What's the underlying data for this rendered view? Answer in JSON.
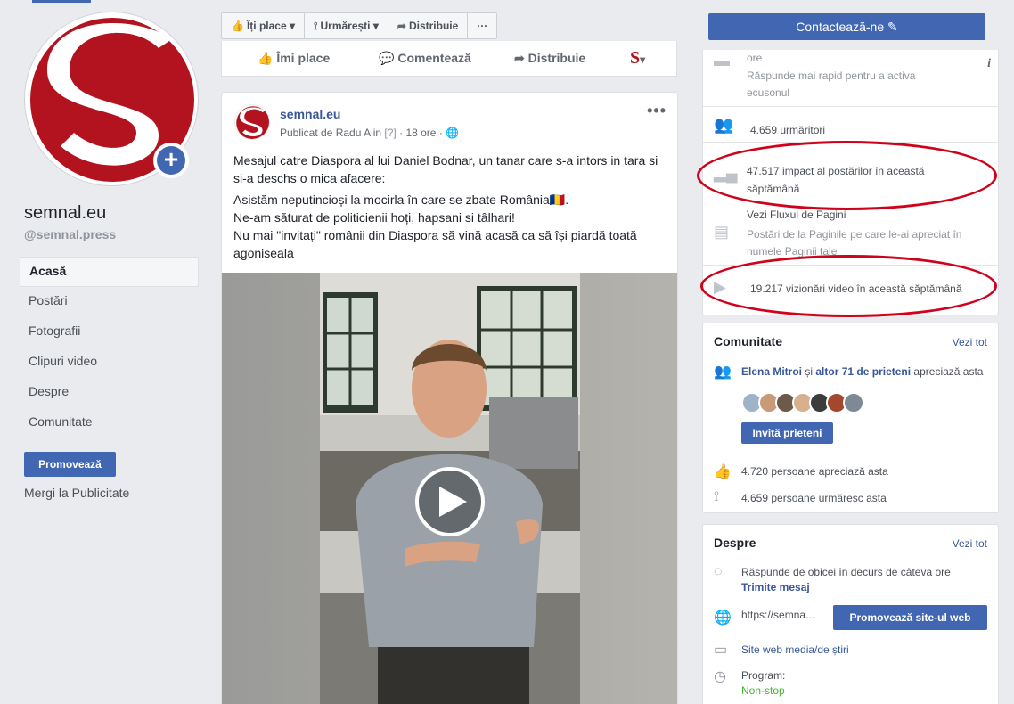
{
  "page": {
    "name": "semnal.eu",
    "handle": "@semnal.press"
  },
  "left_nav": {
    "items": [
      "Acasă",
      "Postări",
      "Fotografii",
      "Clipuri video",
      "Despre",
      "Comunitate"
    ],
    "promote_label": "Promovează",
    "ads_link": "Mergi la Publicitate"
  },
  "toolbar": {
    "like": "Îți place",
    "follow": "Urmărești",
    "share": "Distribuie",
    "more": "···",
    "contact": "Contactează-ne"
  },
  "action_row": {
    "like": "Îmi place",
    "comment": "Comentează",
    "share": "Distribuie"
  },
  "post": {
    "author": "semnal.eu",
    "published_by": "Publicat de Radu Alin",
    "help_mark": "[?]",
    "time": "18 ore",
    "dots": "•••",
    "para1": "Mesajul catre Diaspora al lui Daniel Bodnar, un tanar care s-a intors in tara si si-a deschs o mica afacere:",
    "line1": "Asistăm neputincioși la mocirla în care se zbate România🇷🇴.",
    "line2": "Ne-am săturat de politicienii hoți, hapsani si tâlhari!",
    "line3": "Nu mai \"invitați\" românii din Diaspora să vină acasă ca să își piardă toată agoniseala"
  },
  "stats": {
    "response_hours": "ore",
    "response_hint": "Răspunde mai rapid pentru a activa ecusonul",
    "info_icon": "i",
    "followers": "4.659 urmăritori",
    "impact": "47.517 impact al postărilor în această săptămână",
    "feed_title": "Vezi Fluxul de Pagini",
    "feed_desc": "Postări de la Paginile pe care le-ai apreciat în numele Paginii tale",
    "video_views": "19.217 vizionări video în această săptămână"
  },
  "community": {
    "title": "Comunitate",
    "see_all": "Vezi tot",
    "friend_name": "Elena Mitroi",
    "and": "și",
    "others": "altor 71 de prieteni",
    "likes_suffix": "apreciază asta",
    "invite": "Invită prieteni",
    "likes_count": "4.720 persoane apreciază asta",
    "follows_count": "4.659 persoane urmăresc asta"
  },
  "about": {
    "title": "Despre",
    "see_all": "Vezi tot",
    "response": "Răspunde de obicei în decurs de câteva ore",
    "send_message": "Trimite mesaj",
    "website": "https://semna...",
    "promote_web": "Promovează site-ul web",
    "category": "Site web media/de știri",
    "program_label": "Program:",
    "program_value": "Non-stop"
  },
  "colors": {
    "brand_blue": "#4267b2",
    "logo_red": "#b3121f",
    "annotation_red": "#d0021b",
    "open_green": "#42b72a"
  }
}
